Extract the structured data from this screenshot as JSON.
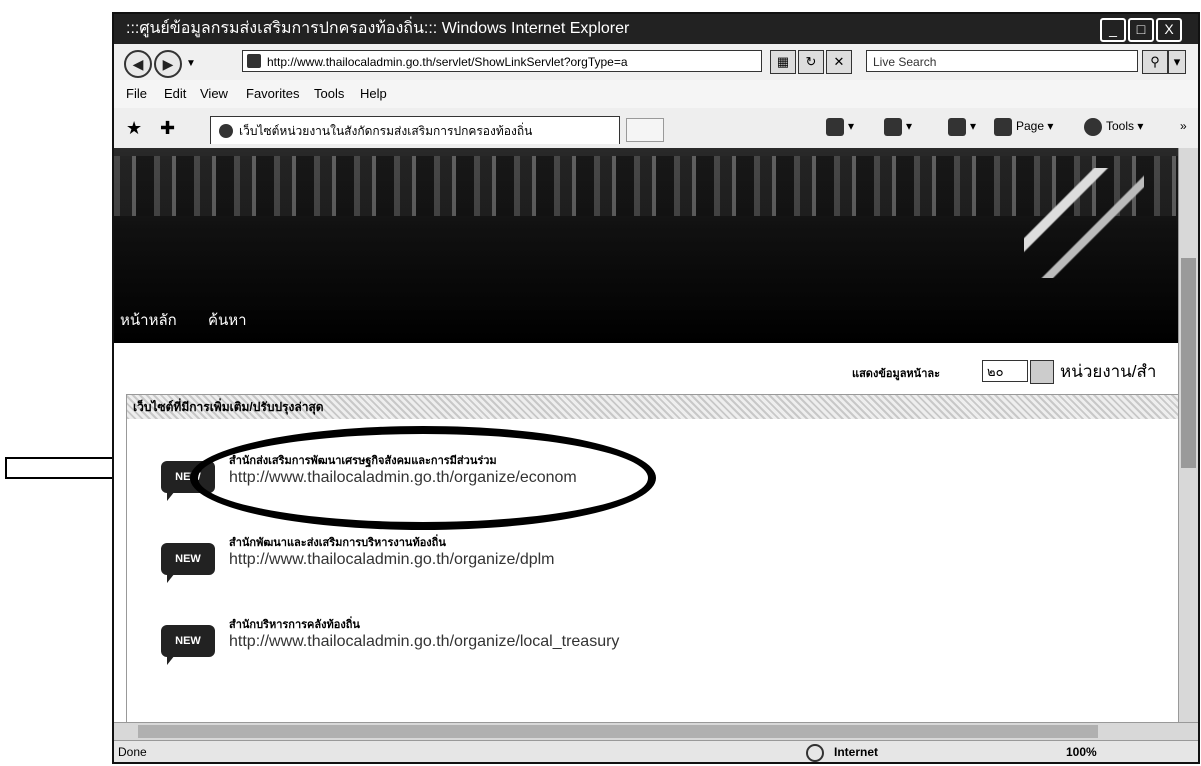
{
  "window": {
    "title": ":::ศูนย์ข้อมูลกรมส่งเสริมการปกครองท้องถิ่น:::  Windows Internet Explorer",
    "minimize": "_",
    "maximize": "□",
    "close": "X"
  },
  "address_bar": {
    "url": "http://www.thailocaladmin.go.th/servlet/ShowLinkServlet?orgType=a",
    "search_placeholder": "Live Search"
  },
  "menu": {
    "file": "File",
    "edit": "Edit",
    "view": "View",
    "favorites": "Favorites",
    "tools": "Tools",
    "help": "Help"
  },
  "tabs": {
    "active": "เว็บไซต์หน่วยงานในสังกัดกรมส่งเสริมการปกครองท้องถิ่น"
  },
  "command_bar": {
    "page": "Page",
    "tools": "Tools"
  },
  "banner_nav": {
    "home": "หน้าหลัก",
    "search": "ค้นหา"
  },
  "display": {
    "label": "แสดงข้อมูลหน้าละ",
    "value": "๒๐",
    "unit": "หน่วยงาน/สำ"
  },
  "list": {
    "header": "เว็บไซต์ที่มีการเพิ่มเติม/ปรับปรุงล่าสุด",
    "badge": "NEW",
    "items": [
      {
        "title": "สำนักส่งเสริมการพัฒนาเศรษฐกิจสังคมและการมีส่วนร่วม",
        "url": "http://www.thailocaladmin.go.th/organize/econom"
      },
      {
        "title": "สำนักพัฒนาและส่งเสริมการบริหารงานท้องถิ่น",
        "url": "http://www.thailocaladmin.go.th/organize/dplm"
      },
      {
        "title": "สำนักบริหารการคลังท้องถิ่น",
        "url": "http://www.thailocaladmin.go.th/organize/local_treasury"
      }
    ]
  },
  "status_bar": {
    "state": "Done",
    "zone": "Internet",
    "zoom": "100%"
  }
}
